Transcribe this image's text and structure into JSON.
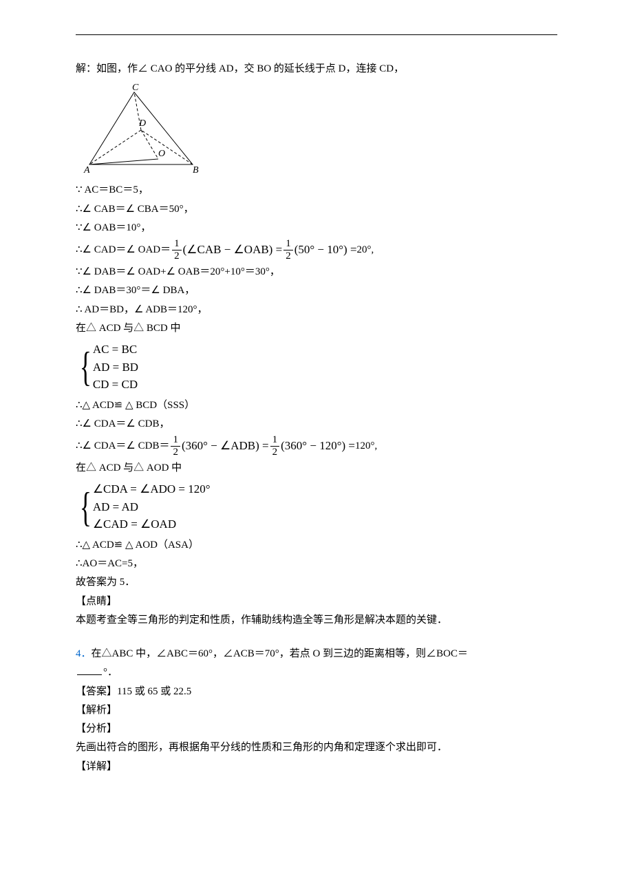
{
  "sol": {
    "intro": "解：如图，作∠ CAO 的平分线 AD，交 BO 的延长线于点 D，连接 CD，",
    "l1": "∵ AC＝BC＝5，",
    "l2": "∴∠ CAB＝∠ CBA＝50°，",
    "l3": "∵∠ OAB＝10°，",
    "l4a": "∴∠ CAD＝∠ OAD＝",
    "l4b": "(∠CAB − ∠OAB) =",
    "l4c": "(50° − 10°) =",
    "l4d": "20°,",
    "l5": "∵∠ DAB＝∠ OAD+∠ OAB＝20°+10°＝30°，",
    "l6": "∴∠ DAB＝30°＝∠ DBA，",
    "l7": "∴ AD＝BD，∠ ADB＝120°，",
    "l8": "在△ ACD 与△ BCD 中",
    "sys1": {
      "r1": "AC = BC",
      "r2": "AD = BD",
      "r3": "CD = CD"
    },
    "l9": "∴△ ACD≌ △ BCD（SSS）",
    "l10": "∴∠ CDA＝∠ CDB，",
    "l11a": "∴∠ CDA＝∠ CDB＝",
    "l11b": "(360° − ∠ADB) =",
    "l11c": "(360° − 120°) =",
    "l11d": "120°,",
    "l12": "在△ ACD 与△ AOD 中",
    "sys2": {
      "r1": "∠CDA = ∠ADO = 120°",
      "r2": "AD = AD",
      "r3": "∠CAD = ∠OAD"
    },
    "l13": "∴△ ACD≌ △ AOD（ASA）",
    "l14": "∴AO＝AC=5，",
    "l15": "故答案为 5．",
    "ds": "【点睛】",
    "dsText": "本题考查全等三角形的判定和性质，作辅助线构造全等三角形是解决本题的关键．"
  },
  "q4": {
    "num": "4．",
    "stem1": "在△ABC 中，∠ABC＝60°，∠ACB＝70°，若点 O 到三边的距离相等，则∠BOC＝",
    "stem2": "°．",
    "ansLabel": "【答案】",
    "ansText": "115 或 65 或 22.5",
    "jxLabel": "【解析】",
    "fxLabel": "【分析】",
    "fxText": "先画出符合的图形，再根据角平分线的性质和三角形的内角和定理逐个求出即可．",
    "xjLabel": "【详解】"
  },
  "frac": {
    "half_n": "1",
    "half_d": "2"
  },
  "fig": {
    "A": "A",
    "B": "B",
    "C": "C",
    "D": "D",
    "O": "O"
  }
}
